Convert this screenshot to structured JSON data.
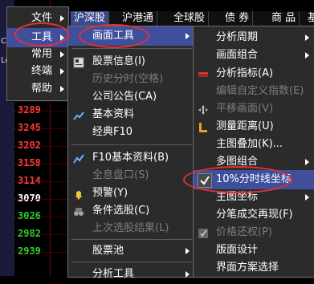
{
  "tabbar": {
    "tabs": [
      "沪深股",
      "沪港通",
      "全球股",
      "债 券",
      "商 品",
      "基"
    ]
  },
  "left_strip_letters": [
    "C",
    "Le"
  ],
  "prices": [
    {
      "v": "3289",
      "c": "red"
    },
    {
      "v": "3245",
      "c": "red"
    },
    {
      "v": "3202",
      "c": "red"
    },
    {
      "v": "3158",
      "c": "red"
    },
    {
      "v": "3114",
      "c": "red"
    },
    {
      "v": "3070",
      "c": "wht"
    },
    {
      "v": "3026",
      "c": "grn"
    },
    {
      "v": "2982",
      "c": "grn"
    },
    {
      "v": "2939",
      "c": "grn"
    }
  ],
  "main_menu": {
    "items": [
      {
        "label": "文件"
      },
      {
        "label": "工具"
      },
      {
        "label": "常用"
      },
      {
        "label": "终端"
      },
      {
        "label": "帮助"
      }
    ]
  },
  "tools_menu": {
    "items": [
      {
        "label": "画面工具",
        "submenu": true
      },
      {
        "label": "股票信息(I)",
        "icon": "stock-info-icon"
      },
      {
        "label": "历史分时(空格)",
        "disabled": true
      },
      {
        "label": "公司公告(CA)"
      },
      {
        "label": "基本资料",
        "icon": "basic-info-icon"
      },
      {
        "label": "经典F10"
      },
      {
        "label": "F10基本资料(B)",
        "icon": "f10-icon"
      },
      {
        "label": "全息盘口(S)",
        "disabled": true
      },
      {
        "label": "预警(Y)",
        "icon": "bell-icon"
      },
      {
        "label": "条件选股(C)",
        "icon": "binoculars-icon"
      },
      {
        "label": "上次选股结果(L)",
        "disabled": true
      },
      {
        "label": "股票池",
        "submenu": true
      },
      {
        "label": "分析工具",
        "submenu": true
      }
    ]
  },
  "screen_tools_menu": {
    "items": [
      {
        "label": "分析周期",
        "submenu": true
      },
      {
        "label": "画面组合",
        "submenu": true
      },
      {
        "label": "分析指标(A)",
        "icon": "indicator-icon"
      },
      {
        "label": "编辑自定义指数(E)",
        "disabled": true
      },
      {
        "label": "平移画面(V)",
        "disabled": true,
        "icon": "pan-icon"
      },
      {
        "label": "测量距离(U)",
        "icon": "ruler-icon"
      },
      {
        "label": "主图叠加(K)..."
      },
      {
        "label": "多图组合",
        "submenu": true
      },
      {
        "label": "10%分时线坐标",
        "checked": true
      },
      {
        "label": "主图坐标",
        "submenu": true
      },
      {
        "label": "分笔成交再现(F)"
      },
      {
        "label": "价格还权(P)",
        "disabled": true,
        "icon": "price-adjust-icon"
      },
      {
        "label": "版面设计"
      },
      {
        "label": "界面方案选择"
      }
    ]
  },
  "colors": {
    "menu_bg": "#2b2b2b",
    "highlight": "#3f4f9c",
    "annotation_red": "#e53030",
    "price_up": "#ff3b3b",
    "price_down": "#2bd32b"
  }
}
